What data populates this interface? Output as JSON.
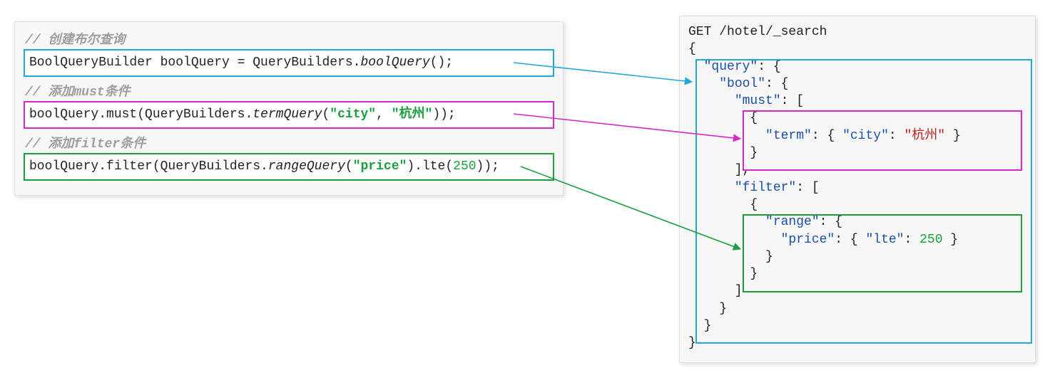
{
  "left": {
    "comment1": "// 创建布尔查询",
    "line1_p1": "BoolQueryBuilder boolQuery = QueryBuilders.",
    "line1_m": "boolQuery",
    "line1_p2": "();",
    "comment2": "// 添加must条件",
    "line2_p1": "boolQuery.must(QueryBuilders.",
    "line2_m": "termQuery",
    "line2_p2": "(",
    "line2_s1": "\"city\"",
    "line2_p3": ", ",
    "line2_s2": "\"杭州\"",
    "line2_p4": "));",
    "comment3": "// 添加filter条件",
    "line3_p1": "boolQuery.filter(QueryBuilders.",
    "line3_m": "rangeQuery",
    "line3_p2": "(",
    "line3_s1": "\"price\"",
    "line3_p3": ").lte(",
    "line3_n1": "250",
    "line3_p4": "));"
  },
  "right": {
    "req": "GET /hotel/_search",
    "l1": "{",
    "l2a": "  ",
    "l2k": "\"query\"",
    "l2b": ": {",
    "l3a": "    ",
    "l3k": "\"bool\"",
    "l3b": ": {",
    "l4a": "      ",
    "l4k": "\"must\"",
    "l4b": ": [",
    "l5": "        {",
    "l6a": "          ",
    "l6k": "\"term\"",
    "l6b": ": { ",
    "l6k2": "\"city\"",
    "l6c": ": ",
    "l6s": "\"杭州\"",
    "l6d": " }",
    "l7": "        }",
    "l8": "      ],",
    "l9a": "      ",
    "l9k": "\"filter\"",
    "l9b": ": [",
    "l10": "        {",
    "l11a": "          ",
    "l11k": "\"range\"",
    "l11b": ": {",
    "l12a": "            ",
    "l12k": "\"price\"",
    "l12b": ": { ",
    "l12k2": "\"lte\"",
    "l12c": ": ",
    "l12n": "250",
    "l12d": " }",
    "l13": "          }",
    "l14": "        }",
    "l15": "      ]",
    "l16": "    }",
    "l17": "  }",
    "l18": "}"
  },
  "colors": {
    "blue": "#22a8d8",
    "magenta": "#d428c8",
    "green": "#1b9e3e"
  }
}
